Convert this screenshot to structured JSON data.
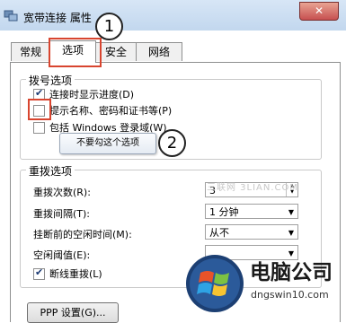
{
  "window": {
    "title": "宽带连接 属性",
    "close_label": "✕",
    "app_icon": "network-connection-icon"
  },
  "callouts": [
    "1",
    "2"
  ],
  "tabs": [
    {
      "label": "常规"
    },
    {
      "label": "选项"
    },
    {
      "label": "安全"
    },
    {
      "label": "网络"
    }
  ],
  "dial_options": {
    "title": "拨号选项",
    "items": [
      {
        "label": "连接时显示进度(D)",
        "checked": true
      },
      {
        "label": "提示名称、密码和证书等(P)",
        "checked": false
      },
      {
        "label": "包括 Windows 登录域(W)",
        "checked": false
      }
    ]
  },
  "tooltip": "不要勾这个选项",
  "redial_options": {
    "title": "重拨选项",
    "redial_attempts": {
      "label": "重拨次数(R):",
      "value": "3"
    },
    "redial_interval": {
      "label": "重拨间隔(T):",
      "value": "1 分钟"
    },
    "idle_before_hangup": {
      "label": "挂断前的空闲时间(M):",
      "value": "从不"
    },
    "idle_threshold": {
      "label": "空闲阈值(E):",
      "value": ""
    },
    "redial_if_dropped": {
      "label": "断线重拨(L)",
      "checked": true
    }
  },
  "ppp_button": "PPP 设置(G)...",
  "watermark": "三联网 3LIAN.COM",
  "brand": {
    "name": "电脑公司",
    "url": "dngswin10.com",
    "logo_icon": "windows-logo-icon"
  },
  "colors": {
    "highlight": "#d8452f",
    "titlebar": "#c9dcf0"
  }
}
